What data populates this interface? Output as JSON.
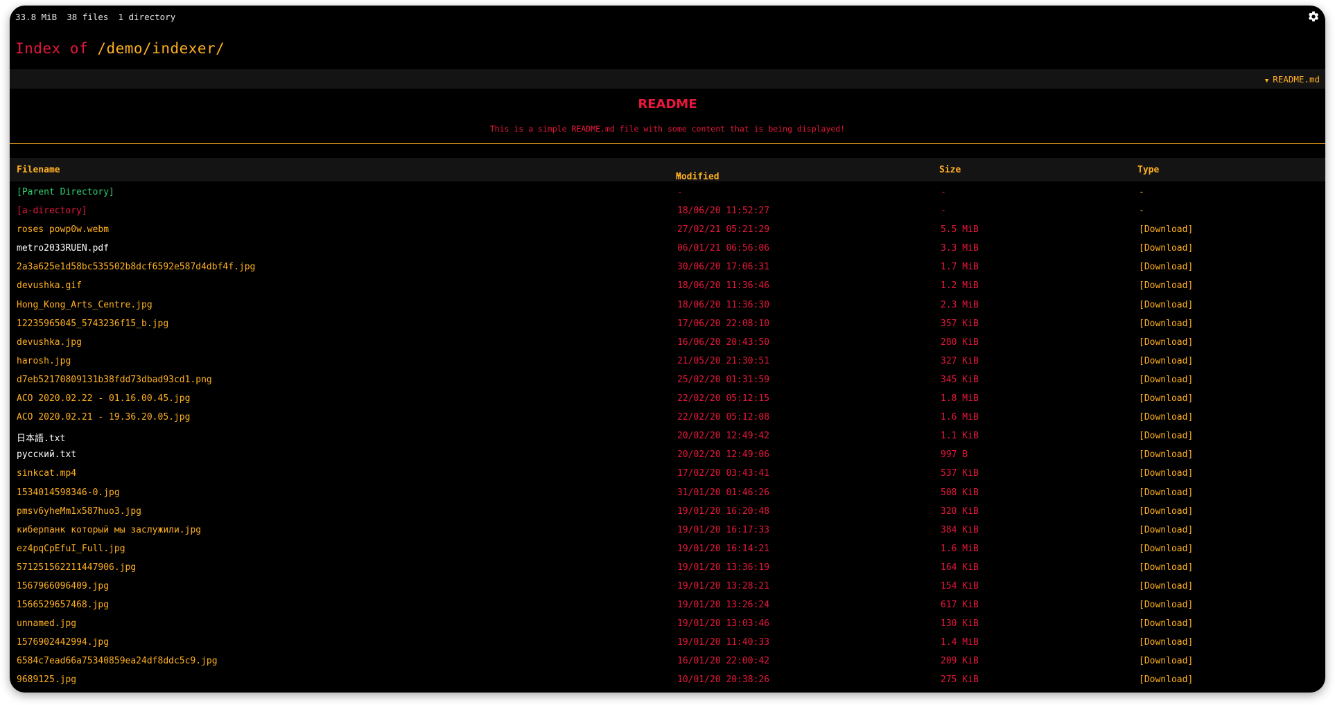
{
  "header": {
    "size": "33.8 MiB",
    "files": "38 files",
    "directories": "1 directory"
  },
  "title": {
    "prefix": "Index of",
    "path": "/demo/indexer/"
  },
  "readme": {
    "toggle_label": "README.md",
    "heading": "README",
    "text": "This is a simple README.md file with some content that is being displayed!"
  },
  "table": {
    "columns": {
      "filename": "Filename",
      "modified": "Modified",
      "sort_indicator": "↑",
      "size": "Size",
      "type": "Type"
    },
    "rows": [
      {
        "name": "[Parent Directory]",
        "modified": "-",
        "size": "-",
        "type": "-",
        "kind": "parent"
      },
      {
        "name": "[a-directory]",
        "modified": "18/06/20 11:52:27",
        "size": "-",
        "type": "-",
        "kind": "dir"
      },
      {
        "name": "roses powp0w.webm",
        "modified": "27/02/21 05:21:29",
        "size": "5.5 MiB",
        "type": "[Download]",
        "kind": "file"
      },
      {
        "name": "metro2033RUEN.pdf",
        "modified": "06/01/21 06:56:06",
        "size": "3.3 MiB",
        "type": "[Download]",
        "kind": "doc"
      },
      {
        "name": "2a3a625e1d58bc535502b8dcf6592e587d4dbf4f.jpg",
        "modified": "30/06/20 17:06:31",
        "size": "1.7 MiB",
        "type": "[Download]",
        "kind": "file"
      },
      {
        "name": "devushka.gif",
        "modified": "18/06/20 11:36:46",
        "size": "1.2 MiB",
        "type": "[Download]",
        "kind": "file"
      },
      {
        "name": "Hong_Kong_Arts_Centre.jpg",
        "modified": "18/06/20 11:36:30",
        "size": "2.3 MiB",
        "type": "[Download]",
        "kind": "file"
      },
      {
        "name": "12235965045_5743236f15_b.jpg",
        "modified": "17/06/20 22:08:10",
        "size": "357 KiB",
        "type": "[Download]",
        "kind": "file"
      },
      {
        "name": "devushka.jpg",
        "modified": "16/06/20 20:43:50",
        "size": "280 KiB",
        "type": "[Download]",
        "kind": "file"
      },
      {
        "name": "harosh.jpg",
        "modified": "21/05/20 21:30:51",
        "size": "327 KiB",
        "type": "[Download]",
        "kind": "file"
      },
      {
        "name": "d7eb52170809131b38fdd73dbad93cd1.png",
        "modified": "25/02/20 01:31:59",
        "size": "345 KiB",
        "type": "[Download]",
        "kind": "file"
      },
      {
        "name": "ACO 2020.02.22 - 01.16.00.45.jpg",
        "modified": "22/02/20 05:12:15",
        "size": "1.8 MiB",
        "type": "[Download]",
        "kind": "file"
      },
      {
        "name": "ACO 2020.02.21 - 19.36.20.05.jpg",
        "modified": "22/02/20 05:12:08",
        "size": "1.6 MiB",
        "type": "[Download]",
        "kind": "file"
      },
      {
        "name": "日本語.txt",
        "modified": "20/02/20 12:49:42",
        "size": "1.1 KiB",
        "type": "[Download]",
        "kind": "doc"
      },
      {
        "name": "русский.txt",
        "modified": "20/02/20 12:49:06",
        "size": "997 B",
        "type": "[Download]",
        "kind": "doc"
      },
      {
        "name": "sinkcat.mp4",
        "modified": "17/02/20 03:43:41",
        "size": "537 KiB",
        "type": "[Download]",
        "kind": "file"
      },
      {
        "name": "1534014598346-0.jpg",
        "modified": "31/01/20 01:46:26",
        "size": "508 KiB",
        "type": "[Download]",
        "kind": "file"
      },
      {
        "name": "pmsv6yheMm1x587huo3.jpg",
        "modified": "19/01/20 16:20:48",
        "size": "320 KiB",
        "type": "[Download]",
        "kind": "file"
      },
      {
        "name": "киберпанк который мы заслужили.jpg",
        "modified": "19/01/20 16:17:33",
        "size": "384 KiB",
        "type": "[Download]",
        "kind": "file"
      },
      {
        "name": "ez4pqCpEfuI_Full.jpg",
        "modified": "19/01/20 16:14:21",
        "size": "1.6 MiB",
        "type": "[Download]",
        "kind": "file"
      },
      {
        "name": "571251562211447906.jpg",
        "modified": "19/01/20 13:36:19",
        "size": "164 KiB",
        "type": "[Download]",
        "kind": "file"
      },
      {
        "name": "1567966096409.jpg",
        "modified": "19/01/20 13:28:21",
        "size": "154 KiB",
        "type": "[Download]",
        "kind": "file"
      },
      {
        "name": "1566529657468.jpg",
        "modified": "19/01/20 13:26:24",
        "size": "617 KiB",
        "type": "[Download]",
        "kind": "file"
      },
      {
        "name": "unnamed.jpg",
        "modified": "19/01/20 13:03:46",
        "size": "130 KiB",
        "type": "[Download]",
        "kind": "file"
      },
      {
        "name": "1576902442994.jpg",
        "modified": "19/01/20 11:40:33",
        "size": "1.4 MiB",
        "type": "[Download]",
        "kind": "file"
      },
      {
        "name": "6584c7ead66a75340859ea24df8ddc5c9.jpg",
        "modified": "16/01/20 22:00:42",
        "size": "209 KiB",
        "type": "[Download]",
        "kind": "file"
      },
      {
        "name": "9689125.jpg",
        "modified": "10/01/20 20:38:26",
        "size": "275 KiB",
        "type": "[Download]",
        "kind": "file"
      }
    ]
  },
  "colors": {
    "background": "#000000",
    "accent_red": "#e8173b",
    "accent_amber": "#ffb020",
    "parent_green": "#2ecc71",
    "stat_text": "#e6e6e6"
  },
  "icons": {
    "settings": "gear-icon",
    "readme_toggle": "triangle-down-icon"
  }
}
